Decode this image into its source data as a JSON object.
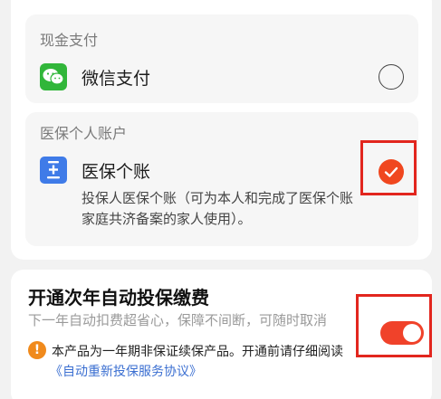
{
  "payment": {
    "cash_section_label": "现金支付",
    "wechat": {
      "label": "微信支付",
      "selected": false,
      "icon": "wechat-icon"
    },
    "medical_section_label": "医保个人账户",
    "medical": {
      "label": "医保个账",
      "description": "投保人医保个账（可为本人和完成了医保个账家庭共济备案的家人使用）。",
      "selected": true,
      "icon": "medical-card-icon"
    }
  },
  "auto_renew": {
    "title": "开通次年自动投保缴费",
    "subtitle": "下一年自动扣费超省心，保障不间断，可随时取消",
    "enabled": true,
    "notice": "本产品为一年期非保证续保产品。开通前请仔细阅读",
    "agreement_link": "《自动重新投保服务协议》"
  },
  "colors": {
    "accent": "#f0422a",
    "wechat_green": "#31b63a",
    "medical_blue": "#3f7be8",
    "warning_orange": "#f08a1c",
    "link_blue": "#3b6fd1",
    "highlight_box": "#e2261e"
  }
}
